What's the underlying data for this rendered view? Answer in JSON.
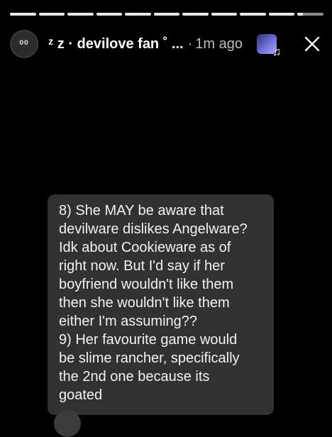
{
  "progress": {
    "segments": 11,
    "filled_fractions": [
      1,
      1,
      1,
      1,
      1,
      1,
      1,
      1,
      1,
      1,
      0.2
    ]
  },
  "header": {
    "username": "ᶻ z · devilove fan ˚ ...",
    "separator": "·",
    "time": "1m ago",
    "avatar_text": "⁰⁰"
  },
  "icons": {
    "music": "music-note-icon",
    "close": "close-icon"
  },
  "story_text": "8) She MAY be aware that\ndevilware dislikes Angelware?\nIdk about Cookieware as of\nright now. But I'd say if her\nboyfriend wouldn't like them\nthen she wouldn't like them\neither I'm assuming??\n9) Her favourite game would\nbe slime rancher, specifically\nthe 2nd one because its\ngoated",
  "colors": {
    "background": "#000000",
    "card": "#313131",
    "progress_filled": "#e9e9e9",
    "progress_empty": "#8a8a8a"
  }
}
